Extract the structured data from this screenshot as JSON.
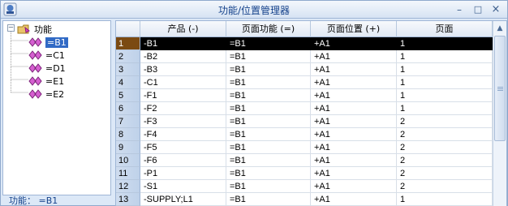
{
  "window": {
    "title": "功能/位置管理器"
  },
  "title_buttons": {
    "minimize": "–",
    "maximize": "□",
    "close": "×"
  },
  "tree": {
    "root": {
      "label": "功能",
      "expander": "–"
    },
    "children": [
      "=B1",
      "=C1",
      "=D1",
      "=E1",
      "=E2"
    ],
    "selected_index": 0
  },
  "status": {
    "text": "功能：  =B1"
  },
  "grid": {
    "columns": [
      "产品 (-)",
      "页面功能 (=)",
      "页面位置 (+)",
      "页面"
    ],
    "rows": [
      [
        "1",
        "-B1",
        "=B1",
        "+A1",
        "1"
      ],
      [
        "2",
        "-B2",
        "=B1",
        "+A1",
        "1"
      ],
      [
        "3",
        "-B3",
        "=B1",
        "+A1",
        "1"
      ],
      [
        "4",
        "-C1",
        "=B1",
        "+A1",
        "1"
      ],
      [
        "5",
        "-F1",
        "=B1",
        "+A1",
        "1"
      ],
      [
        "6",
        "-F2",
        "=B1",
        "+A1",
        "1"
      ],
      [
        "7",
        "-F3",
        "=B1",
        "+A1",
        "2"
      ],
      [
        "8",
        "-F4",
        "=B1",
        "+A1",
        "2"
      ],
      [
        "9",
        "-F5",
        "=B1",
        "+A1",
        "2"
      ],
      [
        "10",
        "-F6",
        "=B1",
        "+A1",
        "2"
      ],
      [
        "11",
        "-P1",
        "=B1",
        "+A1",
        "2"
      ],
      [
        "12",
        "-S1",
        "=B1",
        "+A1",
        "2"
      ],
      [
        "13",
        "-SUPPLY;L1",
        "=B1",
        "+A1",
        "1"
      ]
    ],
    "selected_row": 0
  },
  "colors": {
    "accent": "#15428b",
    "selection": "#000000",
    "row_header_selected": "#7b4a12"
  }
}
